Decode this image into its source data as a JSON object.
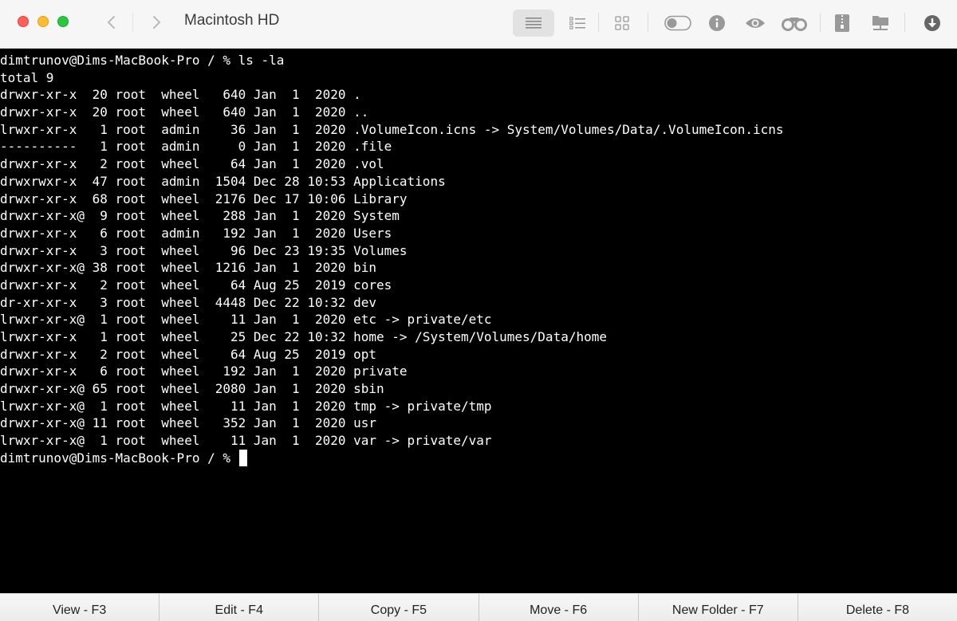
{
  "window": {
    "title": "Macintosh HD"
  },
  "toolbar": {
    "icons": [
      "list-view-icon",
      "detail-list-icon",
      "grid-view-icon",
      "toggle-switch-icon",
      "info-icon",
      "eye-icon",
      "binoculars-icon",
      "archive-icon",
      "network-drive-icon",
      "download-icon"
    ]
  },
  "terminal": {
    "lines": [
      "dimtrunov@Dims-MacBook-Pro / % ls -la",
      "total 9",
      "drwxr-xr-x  20 root  wheel   640 Jan  1  2020 .",
      "drwxr-xr-x  20 root  wheel   640 Jan  1  2020 ..",
      "lrwxr-xr-x   1 root  admin    36 Jan  1  2020 .VolumeIcon.icns -> System/Volumes/Data/.VolumeIcon.icns",
      "----------   1 root  admin     0 Jan  1  2020 .file",
      "drwxr-xr-x   2 root  wheel    64 Jan  1  2020 .vol",
      "drwxrwxr-x  47 root  admin  1504 Dec 28 10:53 Applications",
      "drwxr-xr-x  68 root  wheel  2176 Dec 17 10:06 Library",
      "drwxr-xr-x@  9 root  wheel   288 Jan  1  2020 System",
      "drwxr-xr-x   6 root  admin   192 Jan  1  2020 Users",
      "drwxr-xr-x   3 root  wheel    96 Dec 23 19:35 Volumes",
      "drwxr-xr-x@ 38 root  wheel  1216 Jan  1  2020 bin",
      "drwxr-xr-x   2 root  wheel    64 Aug 25  2019 cores",
      "dr-xr-xr-x   3 root  wheel  4448 Dec 22 10:32 dev",
      "lrwxr-xr-x@  1 root  wheel    11 Jan  1  2020 etc -> private/etc",
      "lrwxr-xr-x   1 root  wheel    25 Dec 22 10:32 home -> /System/Volumes/Data/home",
      "drwxr-xr-x   2 root  wheel    64 Aug 25  2019 opt",
      "drwxr-xr-x   6 root  wheel   192 Jan  1  2020 private",
      "drwxr-xr-x@ 65 root  wheel  2080 Jan  1  2020 sbin",
      "lrwxr-xr-x@  1 root  wheel    11 Jan  1  2020 tmp -> private/tmp",
      "drwxr-xr-x@ 11 root  wheel   352 Jan  1  2020 usr",
      "lrwxr-xr-x@  1 root  wheel    11 Jan  1  2020 var -> private/var"
    ],
    "prompt": "dimtrunov@Dims-MacBook-Pro / % "
  },
  "function_keys": [
    "View - F3",
    "Edit - F4",
    "Copy - F5",
    "Move - F6",
    "New Folder - F7",
    "Delete - F8"
  ]
}
